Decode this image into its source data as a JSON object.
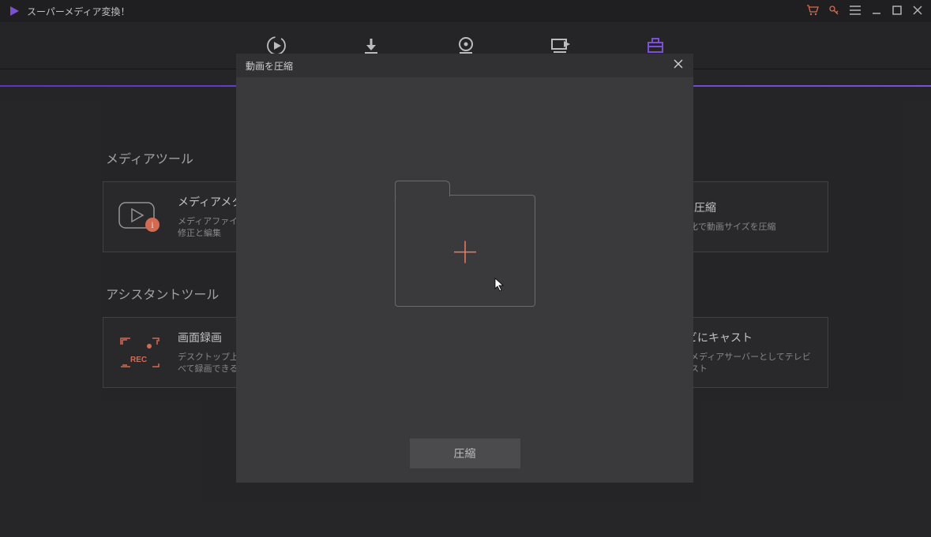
{
  "app": {
    "title": "スーパーメディア変換！"
  },
  "toolbar": {
    "items": [
      "convert",
      "download",
      "burn",
      "transfer",
      "toolbox"
    ],
    "active": 4
  },
  "sections": {
    "media_tools": {
      "title": "メディアツール",
      "cards": [
        {
          "title": "メディアメタデータ修正",
          "desc": "メディアファイルの情報を\n修正と編集"
        },
        {
          "title": "",
          "desc": ""
        },
        {
          "title": "動画圧縮",
          "desc": "無劣化で動画サイズを圧縮"
        }
      ]
    },
    "assistant_tools": {
      "title": "アシスタントツール",
      "cards": [
        {
          "title": "画面録画",
          "desc": "デスクトップ上のものをす\nべて録画できる"
        },
        {
          "title": "",
          "desc": ""
        },
        {
          "title": "テレビにキャスト",
          "desc": "動画をメディアサーバーとしてテレビにキャスト"
        }
      ]
    }
  },
  "modal": {
    "title": "動画を圧縮",
    "button": "圧縮"
  }
}
